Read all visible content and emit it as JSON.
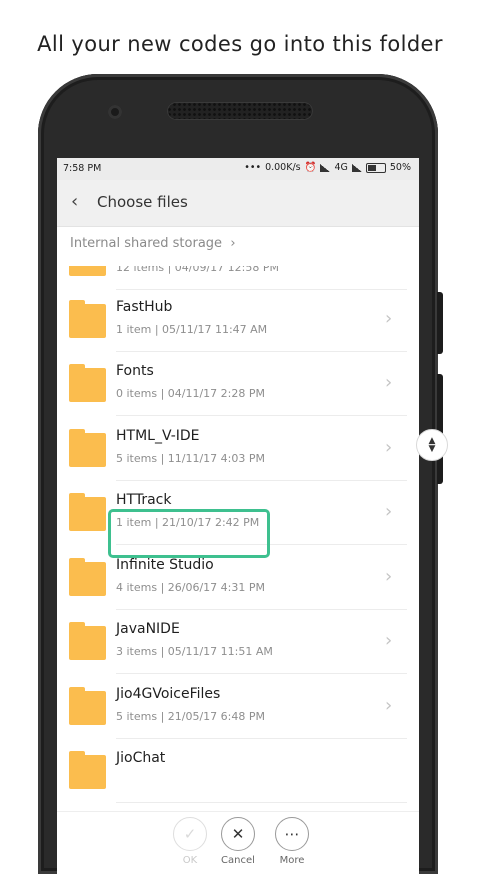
{
  "caption": "All your new codes go into this folder",
  "status_bar": {
    "time": "7:58 PM",
    "speed": "0.00K/s",
    "network": "4G",
    "battery": "50%"
  },
  "app_bar": {
    "back_icon": "‹",
    "title": "Choose files"
  },
  "breadcrumb": "Internal shared storage",
  "folders": [
    {
      "name": "",
      "meta": "12 items | 04/09/17 12:58 PM"
    },
    {
      "name": "FastHub",
      "meta": "1 item | 05/11/17 11:47 AM"
    },
    {
      "name": "Fonts",
      "meta": "0 items | 04/11/17 2:28 PM"
    },
    {
      "name": "HTML_V-IDE",
      "meta": "5 items | 11/11/17 4:03 PM"
    },
    {
      "name": "HTTrack",
      "meta": "1 item | 21/10/17 2:42 PM"
    },
    {
      "name": "Infinite Studio",
      "meta": "4 items | 26/06/17 4:31 PM"
    },
    {
      "name": "JavaNIDE",
      "meta": "3 items | 05/11/17 11:51 AM"
    },
    {
      "name": "Jio4GVoiceFiles",
      "meta": "5 items | 21/05/17 6:48 PM"
    },
    {
      "name": "JioChat",
      "meta": ""
    }
  ],
  "highlight_color": "#3ec08f",
  "folder_color": "#fbbd4e",
  "footer": {
    "ok": "OK",
    "cancel": "Cancel",
    "more": "More"
  }
}
